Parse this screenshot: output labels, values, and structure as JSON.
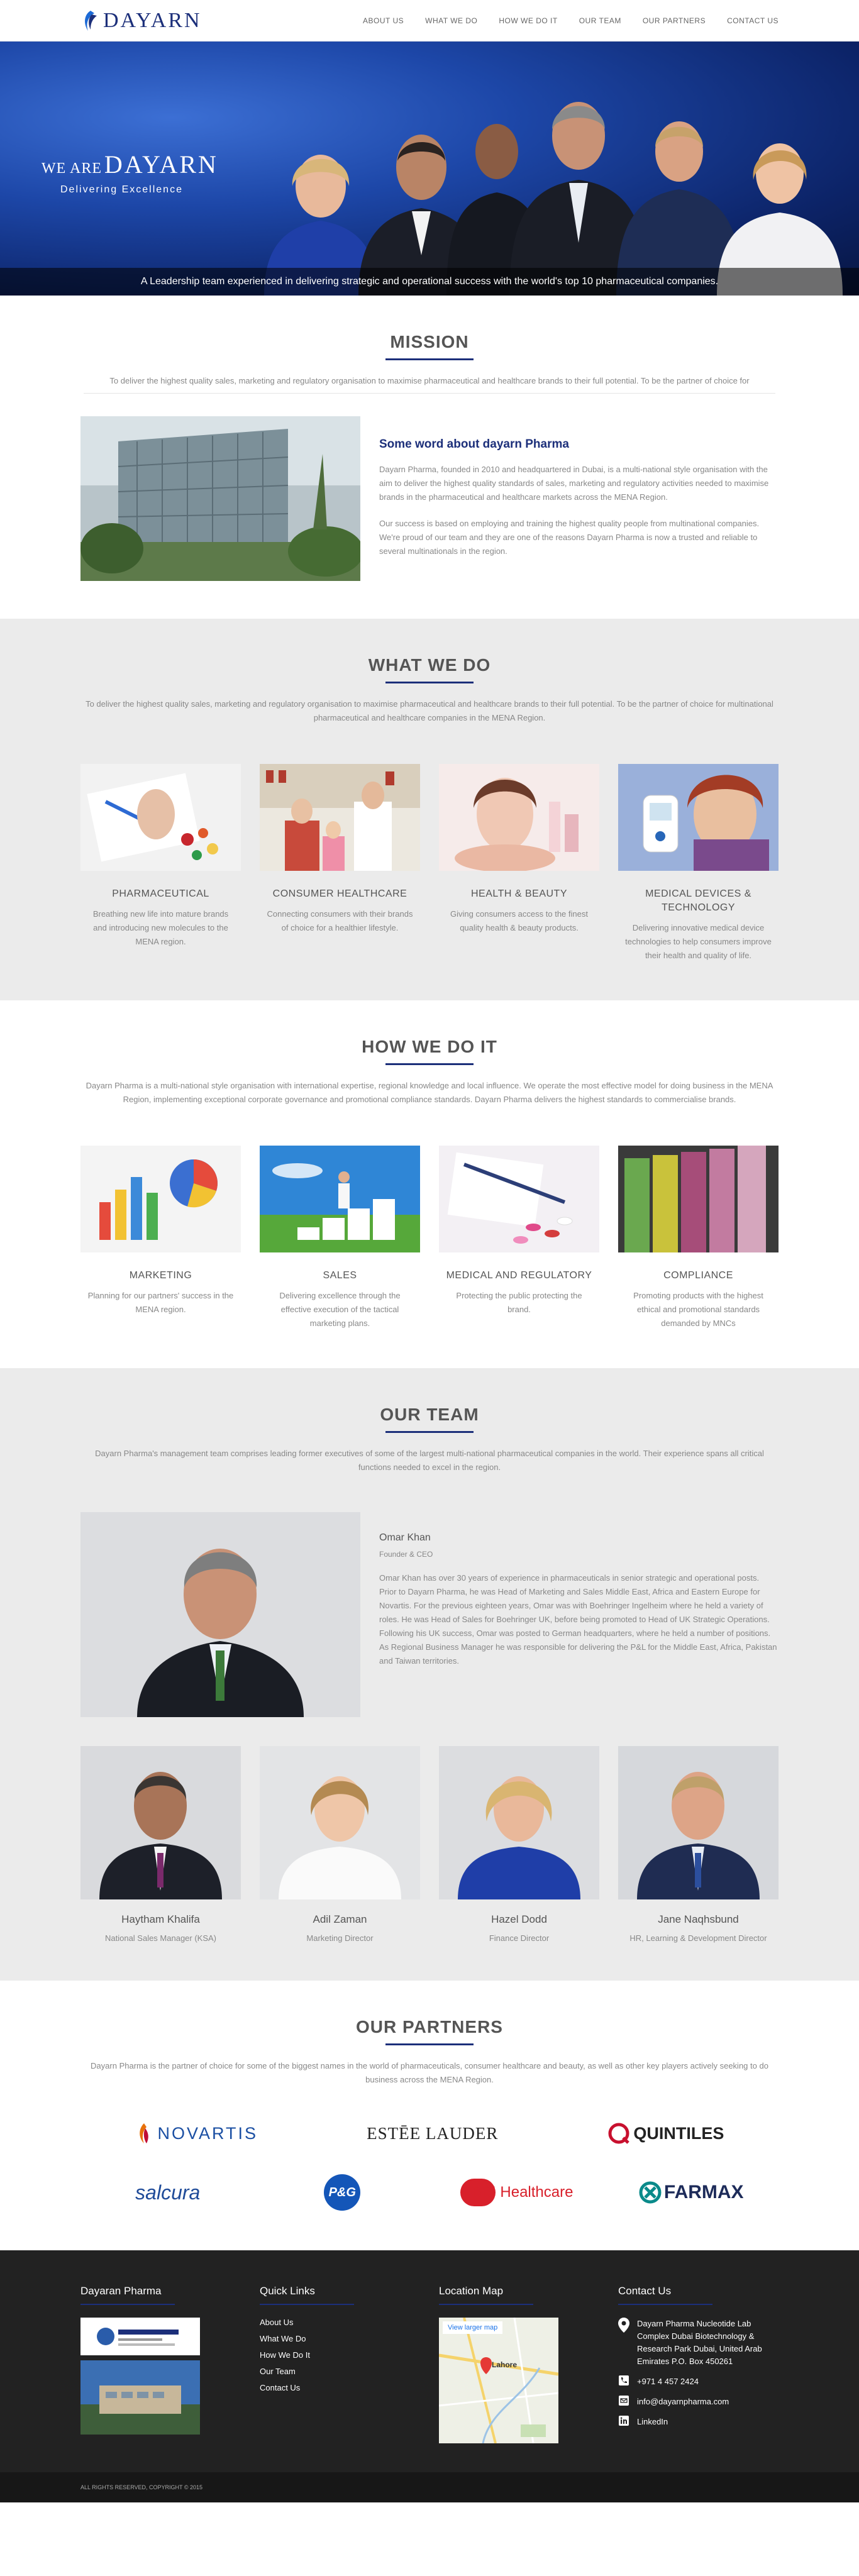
{
  "brand": {
    "name": "DAYARN"
  },
  "nav": [
    "ABOUT US",
    "WHAT WE DO",
    "HOW WE DO IT",
    "OUR TEAM",
    "OUR PARTNERS",
    "CONTACT US"
  ],
  "hero": {
    "we_are": "WE ARE",
    "brand": "DAYARN",
    "tagline": "Delivering Excellence",
    "caption": "A Leadership team experienced in delivering strategic and operational success with the world's top 10 pharmaceutical companies."
  },
  "mission": {
    "title": "MISSION",
    "intro": "To deliver the highest quality sales, marketing and regulatory organisation to maximise pharmaceutical and healthcare brands to their full potential. To be the partner of choice for",
    "about_title": "Some word about dayarn Pharma",
    "p1": "Dayarn Pharma, founded in 2010 and headquartered in Dubai, is a multi-national style organisation with the aim to deliver the highest quality standards of sales, marketing and regulatory activities needed to maximise brands in the pharmaceutical and healthcare markets across the MENA Region.",
    "p2": "Our success is based on employing and training the highest quality people from multinational companies. We're proud of our team and they are one of the reasons Dayarn Pharma is now a trusted and reliable to several multinationals in the region."
  },
  "what": {
    "title": "WHAT WE DO",
    "intro": "To deliver the highest quality sales, marketing and regulatory organisation to maximise pharmaceutical and healthcare brands to their full potential. To be the partner of choice for multinational pharmaceutical and healthcare companies in the MENA Region.",
    "cards": [
      {
        "title": "PHARMACEUTICAL",
        "text": "Breathing new life into mature brands and introducing new molecules to the MENA region."
      },
      {
        "title": "CONSUMER HEALTHCARE",
        "text": "Connecting consumers with their brands of choice for a healthier lifestyle."
      },
      {
        "title": "HEALTH & BEAUTY",
        "text": "Giving consumers access to the finest quality health & beauty products."
      },
      {
        "title": "MEDICAL DEVICES & TECHNOLOGY",
        "text": "Delivering innovative medical device technologies to help consumers improve their health and quality of life."
      }
    ]
  },
  "how": {
    "title": "HOW WE DO IT",
    "intro": "Dayarn Pharma is a multi-national style organisation with international expertise, regional knowledge and local influence. We operate the most effective model for doing business in the MENA Region, implementing exceptional corporate governance and promotional compliance standards. Dayarn Pharma delivers the highest standards to commercialise brands.",
    "cards": [
      {
        "title": "MARKETING",
        "text": "Planning for our partners' success in the MENA region."
      },
      {
        "title": "SALES",
        "text": "Delivering excellence through the effective execution of the tactical marketing plans."
      },
      {
        "title": "MEDICAL AND REGULATORY",
        "text": "Protecting the public protecting the brand."
      },
      {
        "title": "COMPLIANCE",
        "text": "Promoting products with the highest ethical and promotional standards demanded by MNCs"
      }
    ]
  },
  "team": {
    "title": "OUR TEAM",
    "intro": "Dayarn Pharma's management team comprises leading former executives of some of the largest multi-national pharmaceutical companies in the world. Their experience spans all critical functions needed to excel in the region.",
    "lead": {
      "name": "Omar Khan",
      "role": "Founder & CEO",
      "bio": "Omar Khan has over 30 years of experience in pharmaceuticals in senior strategic and operational posts. Prior to Dayarn Pharma, he was Head of Marketing and Sales Middle East, Africa and Eastern Europe for Novartis. For the previous eighteen years, Omar was with Boehringer Ingelheim where he held a variety of roles. He was Head of Sales for Boehringer UK, before being promoted to Head of UK Strategic Operations. Following his UK success, Omar was posted to German headquarters, where he held a number of positions. As Regional Business Manager he was responsible for delivering the P&L for the Middle East, Africa, Pakistan and Taiwan territories."
    },
    "members": [
      {
        "name": "Haytham Khalifa",
        "role": "National Sales Manager (KSA)"
      },
      {
        "name": "Adil Zaman",
        "role": "Marketing Director"
      },
      {
        "name": "Hazel Dodd",
        "role": "Finance Director"
      },
      {
        "name": "Jane Naqhsbund",
        "role": "HR, Learning & Development Director"
      }
    ]
  },
  "partners": {
    "title": "OUR PARTNERS",
    "intro": "Dayarn Pharma is the partner of choice for some of the biggest names in the world of pharmaceuticals, consumer healthcare and beauty, as well as other key players actively seeking to do business across the MENA Region.",
    "logos": [
      "NOVARTIS",
      "ESTĒE LAUDER",
      "QUINTILES",
      "salcura",
      "P&G",
      "BBI Healthcare",
      "FARMAX"
    ]
  },
  "footer": {
    "col1_title": "Dayaran Pharma",
    "col2_title": "Quick Links",
    "links": [
      "About Us",
      "What We Do",
      "How We Do It",
      "Our Team",
      "Contact Us"
    ],
    "col3_title": "Location Map",
    "map_button": "View larger map",
    "map_city": "Lahore",
    "col4_title": "Contact Us",
    "address": "Dayarn Pharma Nucleotide Lab Complex Dubai Biotechnology & Research Park Dubai, United Arab Emirates P.O. Box 450261",
    "phone": "+971 4 457 2424",
    "email": "info@dayarnpharma.com",
    "linkedin": "LinkedIn",
    "copyright": "ALL RIGHTS RESERVED, COPYRIGHT © 2015"
  },
  "colors": {
    "brand_navy": "#1c2f7a",
    "footer_bg": "#222222",
    "section_grey": "#ebebeb"
  }
}
